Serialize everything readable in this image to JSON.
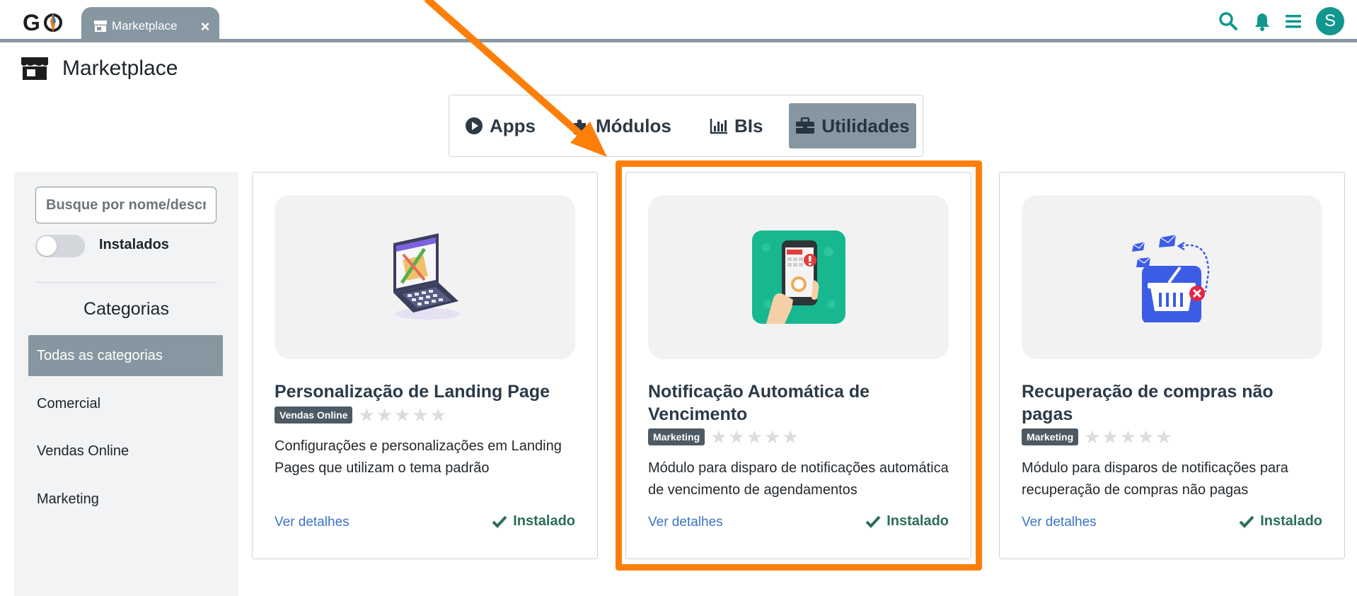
{
  "app": {
    "logo_text": "GO"
  },
  "tab": {
    "icon": "store-icon",
    "label": "Marketplace",
    "close": "×"
  },
  "topbar": {
    "icons": [
      "search-icon",
      "bell-icon",
      "menu-icon"
    ],
    "avatar": "S"
  },
  "page": {
    "icon": "store-icon",
    "title": "Marketplace"
  },
  "segments": [
    {
      "label": "Apps",
      "icon": "play-circle-icon",
      "active": false
    },
    {
      "label": "Módulos",
      "icon": "puzzle-icon",
      "active": false
    },
    {
      "label": "BIs",
      "icon": "bar-chart-icon",
      "active": false
    },
    {
      "label": "Utilidades",
      "icon": "toolbox-icon",
      "active": true
    }
  ],
  "sidebar": {
    "search_placeholder": "Busque por nome/descrição",
    "toggle_label": "Instalados",
    "toggle_on": false,
    "categories_title": "Categorias",
    "categories": [
      {
        "label": "Todas as categorias",
        "active": true
      },
      {
        "label": "Comercial",
        "active": false
      },
      {
        "label": "Vendas Online",
        "active": false
      },
      {
        "label": "Marketing",
        "active": false
      }
    ]
  },
  "cards": [
    {
      "title": "Personalização de Landing Page",
      "badge": "Vendas Online",
      "rating": "★★★★★",
      "description": "Configurações e personalizações em Landing Pages que utilizam o tema padrão",
      "link": "Ver detalhes",
      "status": "Instalado",
      "image_icon": "laptop-design-icon"
    },
    {
      "title": "Notificação Automática de Vencimento",
      "badge": "Marketing",
      "rating": "★★★★★",
      "description": "Módulo para disparo de notificações automática de vencimento de agendamentos",
      "link": "Ver detalhes",
      "status": "Instalado",
      "image_icon": "phone-notification-icon"
    },
    {
      "title": "Recuperação de compras não pagas",
      "badge": "Marketing",
      "rating": "★★★★★",
      "description": "Módulo para disparos de notificações para recuperação de compras não pagas",
      "link": "Ver detalhes",
      "status": "Instalado",
      "image_icon": "basket-email-icon"
    }
  ],
  "colors": {
    "accent": "#8797a1",
    "highlight": "#fd7f0a",
    "teal": "#12978f",
    "installed": "#2c6e57",
    "link": "#3d74c4"
  }
}
